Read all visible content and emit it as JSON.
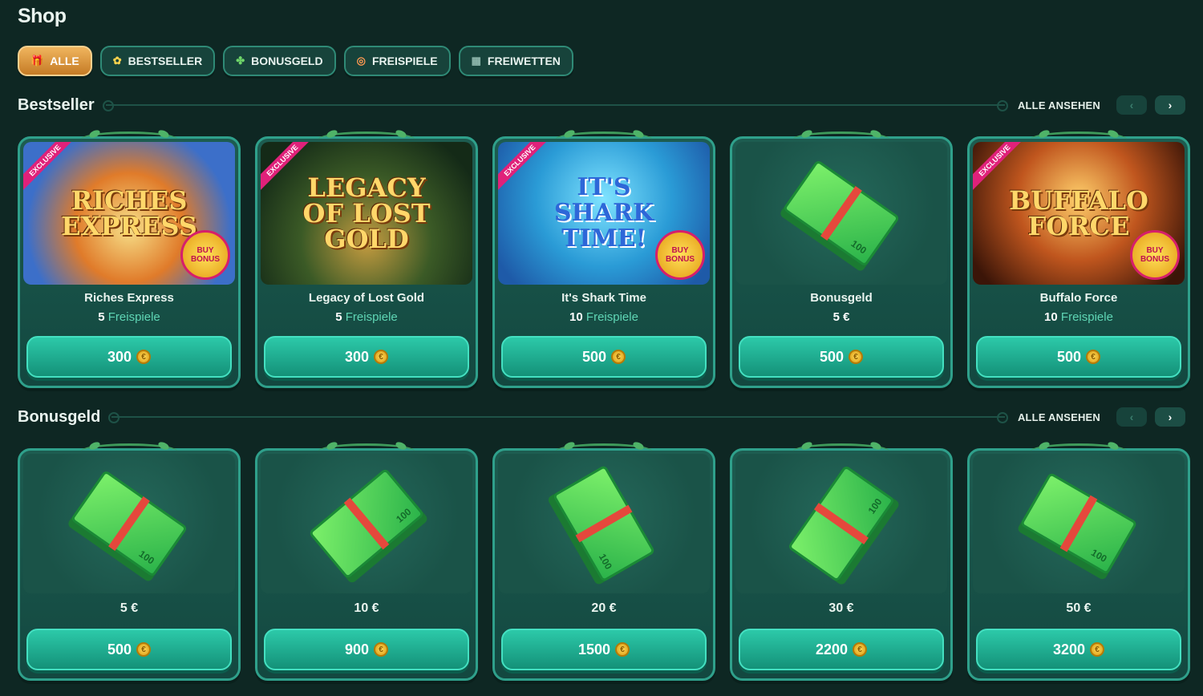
{
  "page": {
    "title": "Shop"
  },
  "filters": [
    {
      "label": "ALLE",
      "icon": "gift-icon",
      "glyph": "🎁",
      "active": true
    },
    {
      "label": "BESTSELLER",
      "icon": "flame-icon",
      "glyph": "✿",
      "active": false
    },
    {
      "label": "BONUSGELD",
      "icon": "cash-icon",
      "glyph": "✤",
      "active": false
    },
    {
      "label": "FREISPIELE",
      "icon": "spin-icon",
      "glyph": "◎",
      "active": false
    },
    {
      "label": "FREIWETTEN",
      "icon": "ticket-icon",
      "glyph": "▦",
      "active": false
    }
  ],
  "sections": [
    {
      "title": "Bestseller",
      "see_all": "ALLE ANSEHEN",
      "cards": [
        {
          "name": "Riches Express",
          "logo": "RICHES EXPRESS",
          "count": "5",
          "unit": "Freispiele",
          "price": "300",
          "exclusive": "EXCLUSIVE",
          "buy_bonus": "BUY BONUS"
        },
        {
          "name": "Legacy of Lost Gold",
          "logo": "LEGACY OF LOST GOLD",
          "count": "5",
          "unit": "Freispiele",
          "price": "300",
          "exclusive": "EXCLUSIVE"
        },
        {
          "name": "It's Shark Time",
          "logo": "IT'S SHARK TIME!",
          "count": "10",
          "unit": "Freispiele",
          "price": "500",
          "exclusive": "EXCLUSIVE",
          "buy_bonus": "BUY BONUS"
        },
        {
          "name": "Bonusgeld",
          "amount": "5 €",
          "price": "500"
        },
        {
          "name": "Buffalo Force",
          "logo": "BUFFALO FORCE",
          "count": "10",
          "unit": "Freispiele",
          "price": "500",
          "exclusive": "EXCLUSIVE",
          "buy_bonus": "BUY BONUS"
        }
      ]
    },
    {
      "title": "Bonusgeld",
      "see_all": "ALLE ANSEHEN",
      "cards": [
        {
          "amount": "5 €",
          "price": "500"
        },
        {
          "amount": "10 €",
          "price": "900"
        },
        {
          "amount": "20 €",
          "price": "1500"
        },
        {
          "amount": "30 €",
          "price": "2200"
        },
        {
          "amount": "50 €",
          "price": "3200"
        }
      ]
    }
  ],
  "colors": {
    "background": "#0e2723",
    "accent": "#2cc9a9",
    "active_filter": "#e09a3c"
  }
}
